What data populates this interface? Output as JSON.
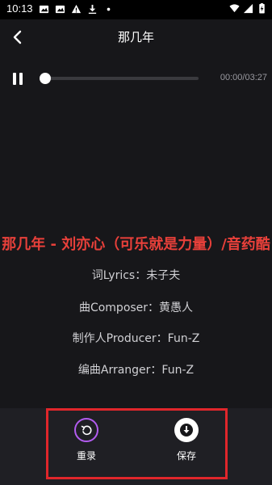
{
  "status_bar": {
    "time": "10:13",
    "left_icons": [
      "image-icon",
      "image-icon",
      "warning-icon",
      "download-icon",
      "dot-icon"
    ],
    "right_icons": [
      "wifi-icon",
      "signal-icon",
      "battery-charging-icon"
    ]
  },
  "header": {
    "title": "那几年",
    "back_icon": "chevron-left-icon"
  },
  "player": {
    "state_icon": "pause-icon",
    "time": "00:00/03:27",
    "progress": 0.0
  },
  "lyrics": {
    "current": "那几年 - 刘亦心（可乐就是力量）/音药酷",
    "lines": [
      "词Lyrics：未子夫",
      "曲Composer：黄愚人",
      "制作人Producer：Fun-Z",
      "编曲Arranger：Fun-Z"
    ]
  },
  "actions": {
    "rerecord_label": "重录",
    "save_label": "保存"
  },
  "colors": {
    "background": "#17171a",
    "current_lyric": "#e8403a",
    "highlight": "#e0262b",
    "rerecord_ring": "#b35cf0"
  }
}
